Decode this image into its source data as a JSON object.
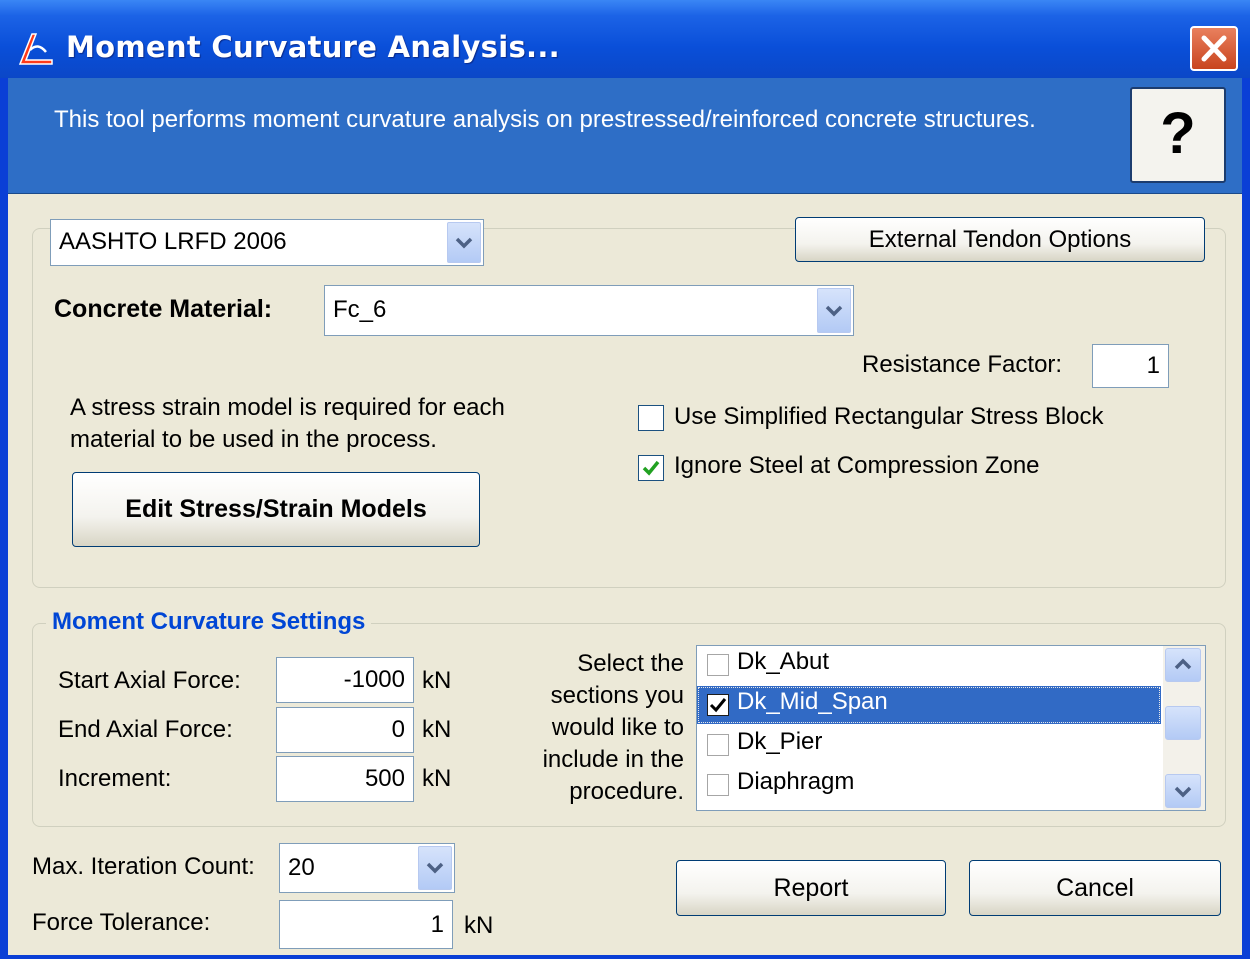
{
  "window": {
    "title": "Moment Curvature Analysis..."
  },
  "banner": {
    "description": "This tool performs moment curvature analysis on prestressed/reinforced concrete structures.",
    "help_label": "?"
  },
  "code": {
    "selected": "AASHTO LRFD 2006"
  },
  "external_tendon_label": "External Tendon Options",
  "concrete": {
    "label": "Concrete Material:",
    "selected": "Fc_6"
  },
  "resistance": {
    "label": "Resistance Factor:",
    "value": "1"
  },
  "stress_note": "A stress strain model is required for each material to be used in the process.",
  "edit_models_label": "Edit Stress/Strain Models",
  "options": {
    "simplified_label": "Use Simplified Rectangular Stress Block",
    "simplified_checked": false,
    "ignore_steel_label": "Ignore Steel at Compression Zone",
    "ignore_steel_checked": true
  },
  "settings": {
    "title": "Moment Curvature Settings",
    "start_label": "Start Axial Force:",
    "start_value": "-1000",
    "end_label": "End Axial Force:",
    "end_value": "0",
    "increment_label": "Increment:",
    "increment_value": "500",
    "unit": "kN",
    "select_note": "Select the sections you would like to include in the procedure.",
    "sections": [
      {
        "label": "Dk_Abut",
        "checked": false,
        "selected": false
      },
      {
        "label": "Dk_Mid_Span",
        "checked": true,
        "selected": true
      },
      {
        "label": "Dk_Pier",
        "checked": false,
        "selected": false
      },
      {
        "label": "Diaphragm",
        "checked": false,
        "selected": false
      }
    ]
  },
  "iteration": {
    "label": "Max. Iteration Count:",
    "selected": "20"
  },
  "tolerance": {
    "label": "Force Tolerance:",
    "value": "1",
    "unit": "kN"
  },
  "buttons": {
    "report": "Report",
    "cancel": "Cancel"
  },
  "colors": {
    "title_bar": "#0a4fd9",
    "banner": "#2e6ec6",
    "dialog_bg": "#ece9d8",
    "group_title": "#0046d5",
    "selection": "#316ac5",
    "check_green": "#21a121"
  }
}
